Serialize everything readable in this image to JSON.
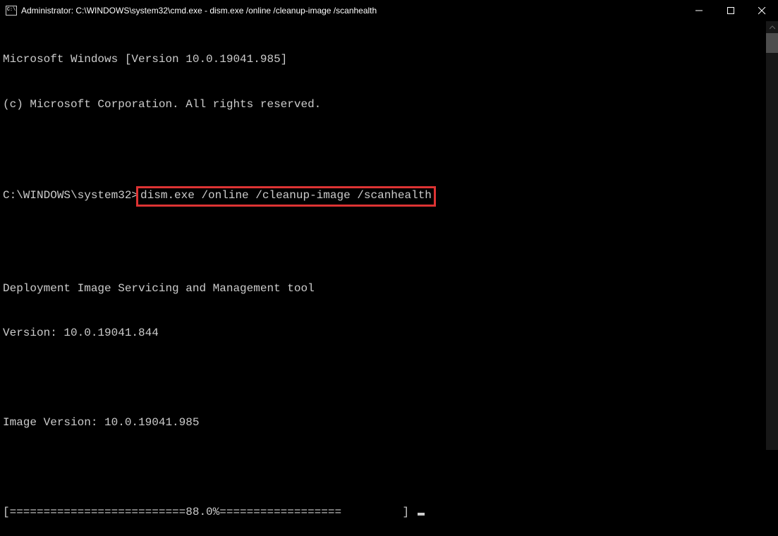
{
  "titlebar": {
    "icon_glyph": "C:\\",
    "text": "Administrator: C:\\WINDOWS\\system32\\cmd.exe - dism.exe  /online /cleanup-image /scanhealth"
  },
  "terminal": {
    "line1": "Microsoft Windows [Version 10.0.19041.985]",
    "line2": "(c) Microsoft Corporation. All rights reserved.",
    "prompt_prefix": "C:\\WINDOWS\\system32>",
    "command": "dism.exe /online /cleanup-image /scanhealth",
    "tool_name": "Deployment Image Servicing and Management tool",
    "tool_version": "Version: 10.0.19041.844",
    "image_version": "Image Version: 10.0.19041.985",
    "progress_line": "[==========================88.0%==================         ] "
  }
}
